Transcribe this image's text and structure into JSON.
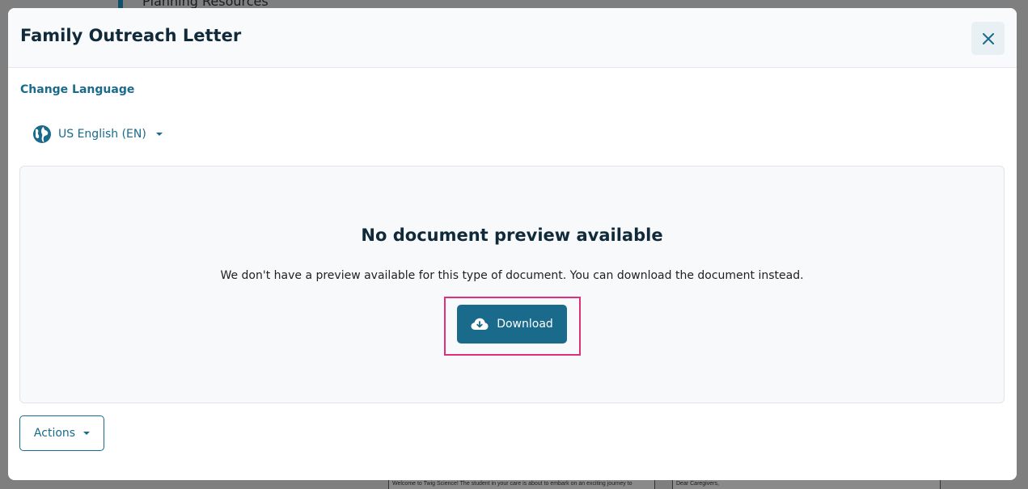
{
  "background": {
    "section_title": "Planning Resources",
    "doc_left_text": "Welcome to Twig Science! The student in your care is about to embark on an exciting journey to",
    "doc_right_text": "Dear Caregivers,"
  },
  "modal": {
    "title": "Family Outreach Letter",
    "close_icon": "close-icon",
    "change_language_label": "Change Language",
    "language": {
      "icon": "globe-icon",
      "selected": "US English (EN)"
    },
    "preview": {
      "heading": "No document preview available",
      "message": "We don't have a preview available for this type of document. You can download the document instead.",
      "download_label": "Download",
      "download_icon": "cloud-download-icon"
    },
    "actions_label": "Actions"
  },
  "colors": {
    "primary": "#1a6a8c",
    "heading": "#102a3a",
    "highlight": "#e0307c",
    "overlay": "#7f7f7f"
  }
}
